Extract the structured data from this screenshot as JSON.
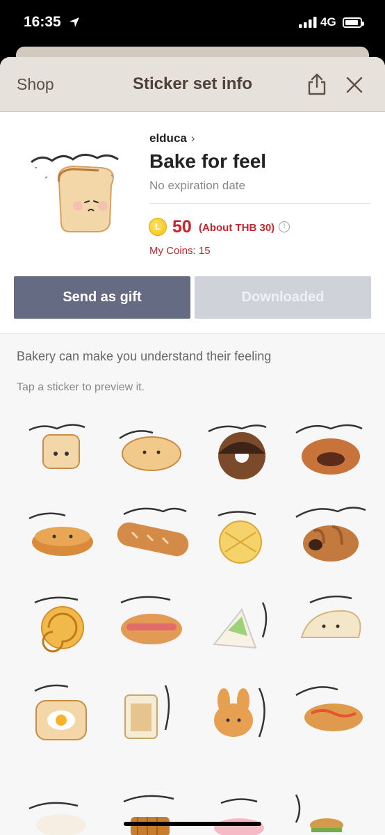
{
  "status_bar": {
    "time": "16:35",
    "network": "4G",
    "battery_level": 0.9
  },
  "nav": {
    "back_label": "Shop",
    "title": "Sticker set info"
  },
  "product": {
    "author": "elduca",
    "title": "Bake for feel",
    "expiry": "No expiration date",
    "coin_symbol": "L",
    "price": "50",
    "price_local": "(About THB 30)",
    "my_coins": "My Coins: 15"
  },
  "buttons": {
    "gift": "Send as gift",
    "downloaded": "Downloaded"
  },
  "description": "Bakery can make you understand their feeling",
  "tap_hint": "Tap a sticker to preview it.",
  "colors": {
    "accent_red": "#c7252b",
    "gift_button": "#646b82",
    "nav_bg": "#e7e1db"
  },
  "stickers": [
    {
      "name": "sticker-bread-loaf"
    },
    {
      "name": "sticker-bun"
    },
    {
      "name": "sticker-chocolate-donut"
    },
    {
      "name": "sticker-bean-bun"
    },
    {
      "name": "sticker-dorayaki"
    },
    {
      "name": "sticker-baguette"
    },
    {
      "name": "sticker-melon-pan"
    },
    {
      "name": "sticker-chocolate-roll"
    },
    {
      "name": "sticker-cinnamon-roll"
    },
    {
      "name": "sticker-hotdog-bun"
    },
    {
      "name": "sticker-sandwich-slice"
    },
    {
      "name": "sticker-bread-slice"
    },
    {
      "name": "sticker-egg-toast"
    },
    {
      "name": "sticker-sandwich"
    },
    {
      "name": "sticker-bunny-bun"
    },
    {
      "name": "sticker-sausage-bread"
    },
    {
      "name": "sticker-dumpling"
    },
    {
      "name": "sticker-waffle"
    },
    {
      "name": "sticker-pink-donut"
    },
    {
      "name": "sticker-burger"
    }
  ]
}
